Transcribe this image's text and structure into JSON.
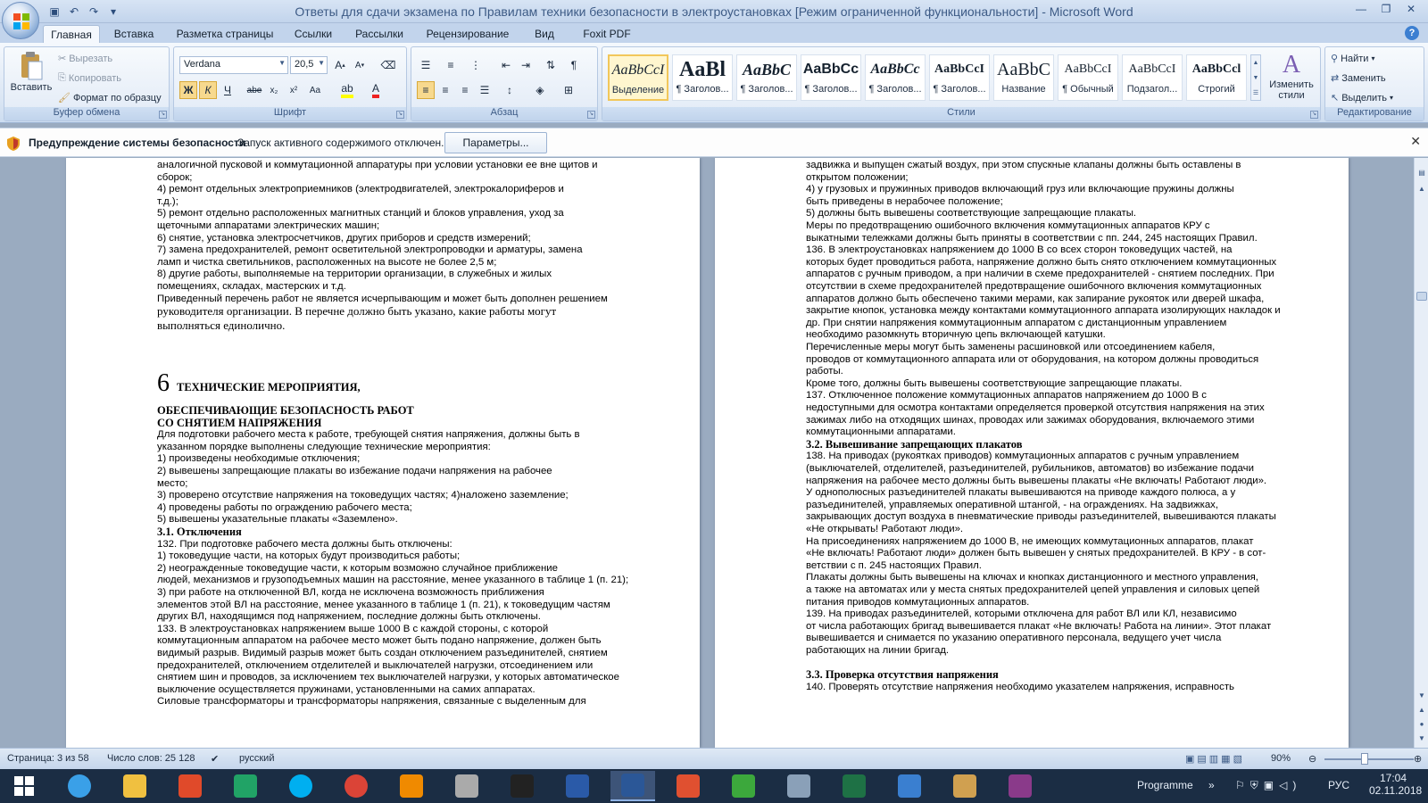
{
  "window": {
    "title": "Ответы для сдачи экзамена по Правилам техники безопасности в электроустановках [Режим ограниченной функциональности] - Microsoft Word"
  },
  "tabs": [
    "Главная",
    "Вставка",
    "Разметка страницы",
    "Ссылки",
    "Рассылки",
    "Рецензирование",
    "Вид",
    "Foxit PDF"
  ],
  "ribbon": {
    "clipboard": {
      "label": "Буфер обмена",
      "paste": "Вставить",
      "cut": "Вырезать",
      "copy": "Копировать",
      "format_painter": "Формат по образцу"
    },
    "font": {
      "label": "Шрифт",
      "family": "Verdana",
      "size": "20,5"
    },
    "paragraph": {
      "label": "Абзац"
    },
    "styles": {
      "label": "Стили",
      "tiles": [
        {
          "preview": "AaBbCcI",
          "name": "Выделение"
        },
        {
          "preview": "AaBl",
          "name": "¶ Заголов..."
        },
        {
          "preview": "AaBbC",
          "name": "¶ Заголов..."
        },
        {
          "preview": "AaBbCc",
          "name": "¶ Заголов..."
        },
        {
          "preview": "AaBbCc",
          "name": "¶ Заголов..."
        },
        {
          "preview": "AaBbCcI",
          "name": "¶ Заголов..."
        },
        {
          "preview": "AaBbC",
          "name": "Название"
        },
        {
          "preview": "AaBbCcI",
          "name": "¶ Обычный"
        },
        {
          "preview": "AaBbCcI",
          "name": "Подзагол..."
        },
        {
          "preview": "AaBbCcl",
          "name": "Строгий"
        }
      ],
      "change": "Изменить стили"
    },
    "editing": {
      "label": "Редактирование",
      "find": "Найти",
      "replace": "Заменить",
      "select": "Выделить"
    }
  },
  "security": {
    "title": "Предупреждение системы безопасности",
    "message": "Запуск активного содержимого отключен.",
    "button": "Параметры..."
  },
  "page_left": [
    {
      "t": "аналогичной пусковой и коммутационной аппаратуры при условии установки ее вне щитов и",
      "c": ""
    },
    {
      "t": "сборок;",
      "c": ""
    },
    {
      "t": "4) ремонт отдельных электроприемников (электродвигателей, электрокалориферов и",
      "c": ""
    },
    {
      "t": "т.д.);",
      "c": ""
    },
    {
      "t": "5) ремонт отдельно расположенных магнитных станций и блоков управления, уход за",
      "c": ""
    },
    {
      "t": "щеточными аппаратами электрических машин;",
      "c": ""
    },
    {
      "t": "6) снятие, установка электросчетчиков, других приборов и средств измерений;",
      "c": ""
    },
    {
      "t": "7) замена предохранителей, ремонт осветительной электропроводки и арматуры, замена",
      "c": ""
    },
    {
      "t": "ламп и чистка светильников, расположенных на высоте не более 2,5 м;",
      "c": ""
    },
    {
      "t": "8) другие работы, выполняемые на территории организации, в служебных и жилых",
      "c": ""
    },
    {
      "t": "помещениях, складах, мастерских и т.д.",
      "c": ""
    },
    {
      "t": "Приведенный перечень работ не является исчерпывающим и может быть дополнен решением",
      "c": ""
    },
    {
      "t": "руководителя организации. В перечне должно быть указано, какие работы могут",
      "c": "serif"
    },
    {
      "t": "выполняться единолично.",
      "c": "serif"
    }
  ],
  "page_left_2": [
    {
      "t": "ОБЕСПЕЧИВАЮЩИЕ БЕЗОПАСНОСТЬ РАБОТ",
      "c": "head"
    },
    {
      "t": "СО СНЯТИЕМ НАПРЯЖЕНИЯ",
      "c": "head"
    },
    {
      "t": "Для подготовки рабочего места к работе, требующей снятия напряжения, должны быть в",
      "c": ""
    },
    {
      "t": "указанном порядке выполнены следующие технические мероприятия:",
      "c": ""
    },
    {
      "t": "1) произведены необходимые отключения;",
      "c": ""
    },
    {
      "t": "2) вывешены запрещающие плакаты во избежание подачи напряжения на рабочее",
      "c": ""
    },
    {
      "t": "место;",
      "c": ""
    },
    {
      "t": "3) проверено отсутствие напряжения на токоведущих частях; 4)наложено заземление;",
      "c": ""
    },
    {
      "t": "4) проведены работы по ограждению рабочего места;",
      "c": ""
    },
    {
      "t": "5) вывешены указательные плакаты «Заземлено».",
      "c": ""
    },
    {
      "t": "3.1. Отключения",
      "c": "head"
    },
    {
      "t": "132. При подготовке рабочего места должны быть отключены:",
      "c": ""
    },
    {
      "t": "1) токоведущие части, на которых будут производиться работы;",
      "c": ""
    },
    {
      "t": "2) неогражденные токоведущие части, к которым возможно случайное приближение",
      "c": ""
    },
    {
      "t": "людей, механизмов и грузоподъемных машин на расстояние, менее указанного в таблице 1 (п. 21);",
      "c": ""
    },
    {
      "t": "3) при работе на отключенной ВЛ, когда не исключена возможность приближения",
      "c": ""
    },
    {
      "t": "элементов этой ВЛ на расстояние, менее указанного в таблице 1 (п. 21), к токоведущим частям",
      "c": ""
    },
    {
      "t": "других ВЛ, находящимся под напряжением, последние должны быть отключены.",
      "c": ""
    },
    {
      "t": "133. В электроустановках напряжением выше 1000 В с каждой стороны, с которой",
      "c": ""
    },
    {
      "t": "коммутационным аппаратом на рабочее место может быть подано напряжение, должен быть",
      "c": ""
    },
    {
      "t": "видимый разрыв. Видимый разрыв может быть создан отключением разъединителей, снятием",
      "c": ""
    },
    {
      "t": "предохранителей, отключением отделителей и выключателей нагрузки, отсоединением или",
      "c": ""
    },
    {
      "t": "снятием шин и проводов, за исключением тех выключателей нагрузки, у которых автоматическое",
      "c": ""
    },
    {
      "t": "выключение осуществляется пружинами, установленными на самих аппаратах.",
      "c": ""
    },
    {
      "t": "Силовые трансформаторы и трансформаторы напряжения, связанные с выделенным для",
      "c": ""
    }
  ],
  "chapter": {
    "num": "6",
    "title": "ТЕХНИЧЕСКИЕ МЕРОПРИЯТИЯ,"
  },
  "page_right": [
    {
      "t": "задвижка и выпущен сжатый воздух, при этом спускные клапаны должны быть оставлены в",
      "c": ""
    },
    {
      "t": "открытом положении;",
      "c": ""
    },
    {
      "t": "4) у грузовых и пружинных приводов включающий груз или включающие пружины должны",
      "c": ""
    },
    {
      "t": "быть приведены в нерабочее положение;",
      "c": ""
    },
    {
      "t": "5) должны быть вывешены соответствующие запрещающие плакаты.",
      "c": ""
    },
    {
      "t": "Меры по предотвращению ошибочного включения коммутационных аппаратов КРУ с",
      "c": ""
    },
    {
      "t": "выкатными тележками должны быть приняты в соответствии с пп. 244, 245 настоящих Правил.",
      "c": ""
    },
    {
      "t": "136. В электроустановках напряжением до 1000 В со всех сторон токоведущих частей, на",
      "c": ""
    },
    {
      "t": "которых будет проводиться работа, напряжение должно быть снято отключением коммутационных",
      "c": ""
    },
    {
      "t": "аппаратов с ручным приводом, а при наличии в схеме предохранителей - снятием последних. При",
      "c": ""
    },
    {
      "t": "отсутствии в схеме предохранителей предотвращение ошибочного включения коммутационных",
      "c": ""
    },
    {
      "t": "аппаратов должно быть обеспечено такими мерами, как запирание рукояток или дверей шкафа,",
      "c": ""
    },
    {
      "t": "закрытие кнопок, установка между контактами коммутационного аппарата изолирующих накладок и",
      "c": ""
    },
    {
      "t": "др. При снятии напряжения коммутационным аппаратом с дистанционным управлением",
      "c": ""
    },
    {
      "t": "необходимо разомкнуть вторичную цепь включающей катушки.",
      "c": ""
    },
    {
      "t": "Перечисленные меры могут быть заменены расшиновкой или отсоединением кабеля,",
      "c": ""
    },
    {
      "t": "проводов от коммутационного аппарата или от оборудования, на котором должны проводиться",
      "c": ""
    },
    {
      "t": "работы.",
      "c": ""
    },
    {
      "t": "Кроме того, должны быть вывешены соответствующие запрещающие плакаты.",
      "c": ""
    },
    {
      "t": "137. Отключенное положение коммутационных аппаратов напряжением до 1000 В с",
      "c": ""
    },
    {
      "t": "недоступными для осмотра контактами определяется проверкой отсутствия напряжения на этих",
      "c": ""
    },
    {
      "t": "зажимах либо на отходящих шинах, проводах или зажимах оборудования, включаемого этими",
      "c": ""
    },
    {
      "t": "коммутационными аппаратами.",
      "c": ""
    },
    {
      "t": "3.2. Вывешивание запрещающих плакатов",
      "c": "head"
    },
    {
      "t": "138. На приводах (рукоятках приводов) коммутационных аппаратов с ручным управлением",
      "c": ""
    },
    {
      "t": "(выключателей, отделителей, разъединителей, рубильников, автоматов) во избежание подачи",
      "c": ""
    },
    {
      "t": "напряжения на рабочее место должны быть вывешены плакаты «Не включать! Работают люди».",
      "c": ""
    },
    {
      "t": "У однополюсных разъединителей плакаты вывешиваются на приводе каждого полюса, а у",
      "c": ""
    },
    {
      "t": "разъединителей, управляемых оперативной штангой, - на ограждениях. На задвижках,",
      "c": ""
    },
    {
      "t": "закрывающих доступ воздуха в пневматические приводы разъединителей, вывешиваются плакаты",
      "c": ""
    },
    {
      "t": "«Не открывать! Работают люди».",
      "c": ""
    },
    {
      "t": "На присоединениях напряжением до 1000 В, не имеющих коммутационных аппаратов, плакат",
      "c": ""
    },
    {
      "t": "«Не включать! Работают люди» должен быть вывешен у снятых предохранителей. В КРУ - в сот-",
      "c": ""
    },
    {
      "t": "ветствии с п. 245 настоящих Правил.",
      "c": ""
    },
    {
      "t": "Плакаты должны быть вывешены на ключах и кнопках дистанционного и местного управления,",
      "c": ""
    },
    {
      "t": "а также на автоматах или у места снятых предохранителей цепей управления и силовых цепей",
      "c": ""
    },
    {
      "t": "питания приводов коммутационных аппаратов.",
      "c": ""
    },
    {
      "t": "139. На приводах разъединителей, которыми отключена для работ ВЛ или КЛ, независимо",
      "c": ""
    },
    {
      "t": "от числа работающих бригад вывешивается плакат «Не включать! Работа на линии». Этот плакат",
      "c": ""
    },
    {
      "t": "вывешивается и снимается по указанию оперативного персонала, ведущего учет числа",
      "c": ""
    },
    {
      "t": "работающих на линии бригад.",
      "c": ""
    },
    {
      "t": "",
      "c": ""
    },
    {
      "t": "3.3. Проверка отсутствия напряжения",
      "c": "head"
    },
    {
      "t": "140. Проверять отсутствие напряжения необходимо указателем напряжения, исправность",
      "c": ""
    }
  ],
  "status": {
    "page": "Страница: 3 из 58",
    "words": "Число слов: 25 128",
    "lang": "русский",
    "zoom": "90%",
    "zoom_level": 0.45
  },
  "taskbar": {
    "apps": [
      "windows",
      "ie",
      "explorer",
      "paint",
      "excel-green",
      "skype",
      "chrome",
      "vlc",
      "mic",
      "cmd",
      "pdf",
      "word",
      "check",
      "frog",
      "calculator",
      "excel",
      "photos",
      "paint-palette",
      "winrar"
    ],
    "toolbar_label": "Programme",
    "lang": "РУС",
    "time": "17:04",
    "date": "02.11.2018"
  }
}
